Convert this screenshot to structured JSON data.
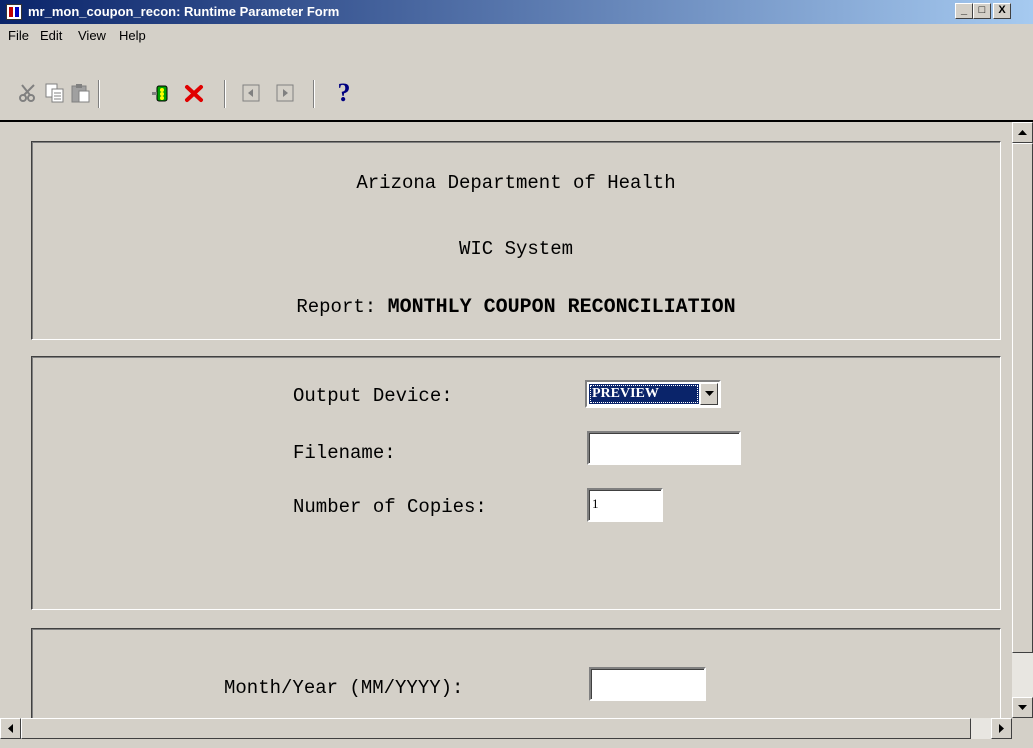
{
  "window": {
    "title": "mr_mon_coupon_recon: Runtime Parameter Form",
    "controls": {
      "minimize": "_",
      "maximize": "□",
      "close": "X"
    }
  },
  "menu": {
    "items": [
      "File",
      "Edit",
      "View",
      "Help"
    ]
  },
  "toolbar": {
    "buttons": [
      "cut-icon",
      "copy-icon",
      "paste-icon",
      "run-report-icon",
      "cancel-icon",
      "previous-page-icon",
      "next-page-icon",
      "help-icon"
    ],
    "help_label": "?"
  },
  "header": {
    "org": "Arizona Department of Health",
    "system": "WIC System",
    "report_prefix": "Report:",
    "report_name": "MONTHLY COUPON RECONCILIATION"
  },
  "params": {
    "output_device_label": "Output Device:",
    "output_device_value": "PREVIEW",
    "filename_label": "Filename:",
    "filename_value": "",
    "copies_label": "Number of Copies:",
    "copies_value": "1"
  },
  "criteria": {
    "month_year_label": "Month/Year (MM/YYYY):",
    "month_year_value": ""
  },
  "colors": {
    "face": "#d4d0c8",
    "titlebar_start": "#0a246a",
    "titlebar_end": "#a6caf0",
    "selection": "#0a246a",
    "cancel_red": "#e00000"
  }
}
